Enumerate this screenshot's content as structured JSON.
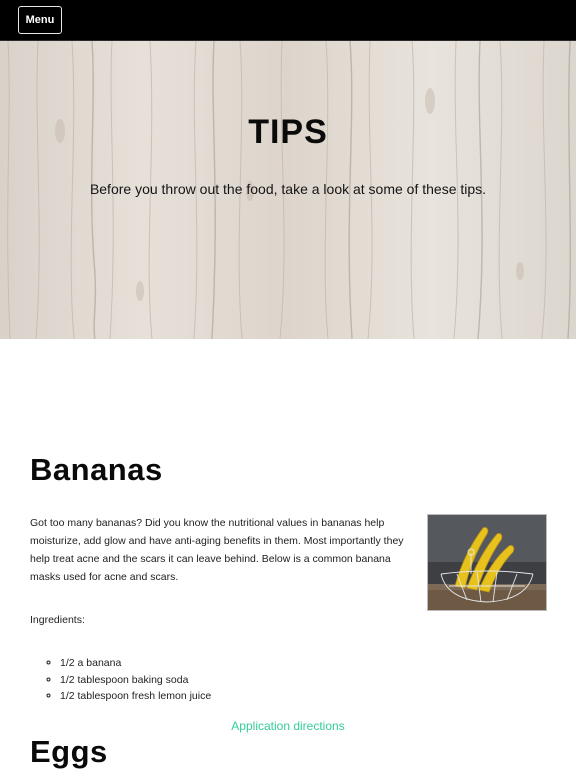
{
  "header": {
    "menu_label": "Menu"
  },
  "hero": {
    "title": "TIPS",
    "subtitle": "Before you throw out the food, take a look at some of these tips."
  },
  "sections": [
    {
      "title": "Bananas",
      "paragraph": "Got too many bananas? Did you know the nutritional values in bananas help moisturize, add glow and have anti-aging benefits in them. Most importantly they help treat acne and the scars it can leave behind. Below is a common banana masks used for acne and scars.",
      "ingredients_label": "Ingredients:",
      "ingredients": [
        "1/2 a banana",
        "1/2 tablespoon baking soda",
        "1/2 tablespoon fresh lemon juice"
      ],
      "link_label": "Application directions",
      "image_icon": "banana-basket-photo"
    },
    {
      "title": "Eggs"
    }
  ],
  "colors": {
    "topbar": "#000000",
    "hero_background": "#ddd6cf",
    "link": "#33cc99",
    "text": "#111111"
  }
}
